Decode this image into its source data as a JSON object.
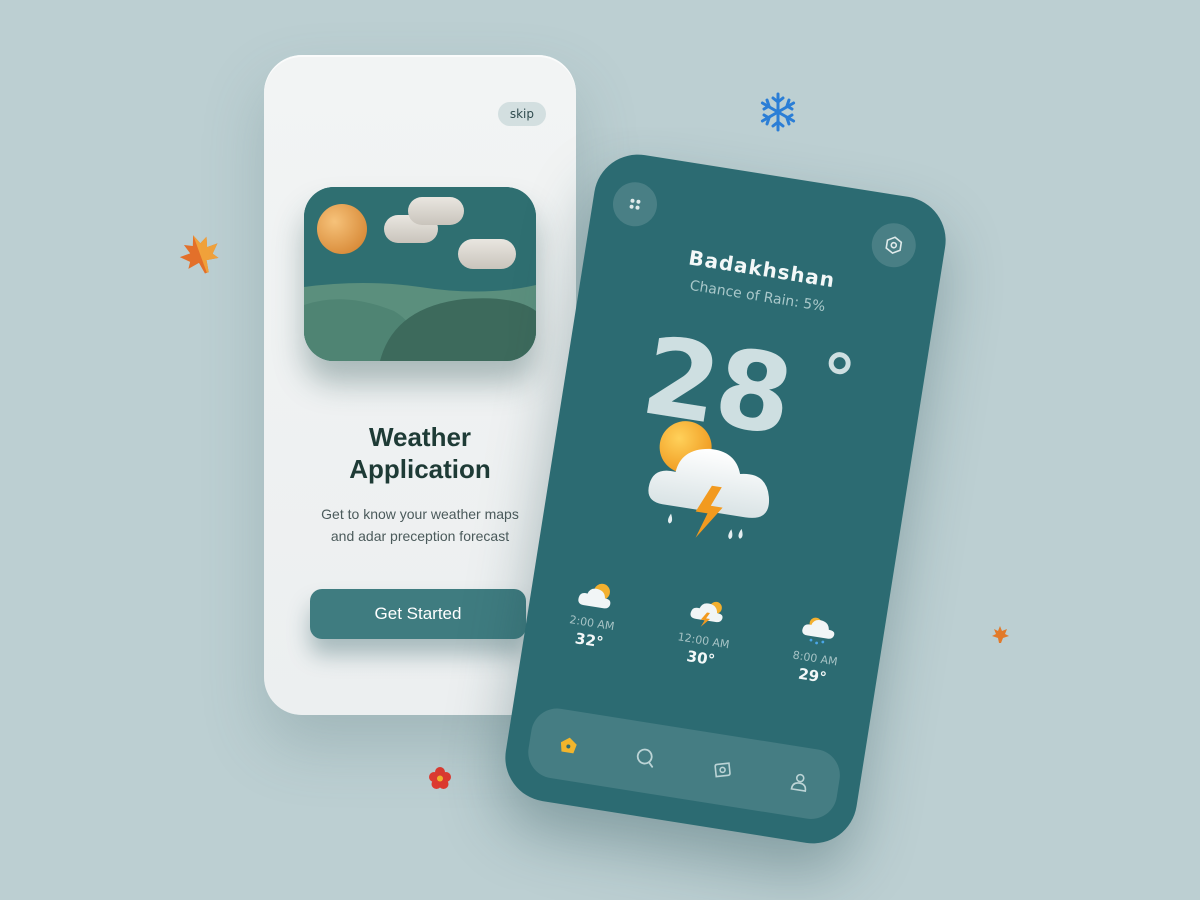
{
  "colors": {
    "background": "#bccfd2",
    "accent_teal": "#3f7c80",
    "phone_dark": "#2c6b72",
    "sun_orange": "#f0a93a",
    "title_dark": "#1e3b36"
  },
  "onboarding": {
    "skip_label": "skip",
    "title_line1": "Weather",
    "title_line2": "Application",
    "description_line1": "Get to know your weather maps",
    "description_line2": "and adar preception forecast",
    "cta_label": "Get Started",
    "illustration_icon": "landscape-sun-clouds-icon"
  },
  "weather": {
    "city": "Badakhshan",
    "rain_chance": "Chance of Rain: 5%",
    "temperature": "28",
    "condition_icon": "thunderstorm-sun-icon",
    "menu_icon": "dots-menu-icon",
    "settings_icon": "settings-hexagon-icon",
    "hourly": [
      {
        "time": "2:00 AM",
        "temp": "32°",
        "icon": "partly-cloudy-icon"
      },
      {
        "time": "12:00 AM",
        "temp": "30°",
        "icon": "thunder-cloud-icon"
      },
      {
        "time": "8:00 AM",
        "temp": "29°",
        "icon": "rain-cloud-icon"
      }
    ]
  },
  "nav": {
    "items": [
      {
        "icon": "home-icon",
        "active": true
      },
      {
        "icon": "search-icon",
        "active": false
      },
      {
        "icon": "compass-icon",
        "active": false
      },
      {
        "icon": "profile-icon",
        "active": false
      }
    ]
  },
  "decorations": [
    "maple-leaf-icon",
    "snowflake-icon",
    "small-leaf-icon",
    "flower-icon"
  ]
}
